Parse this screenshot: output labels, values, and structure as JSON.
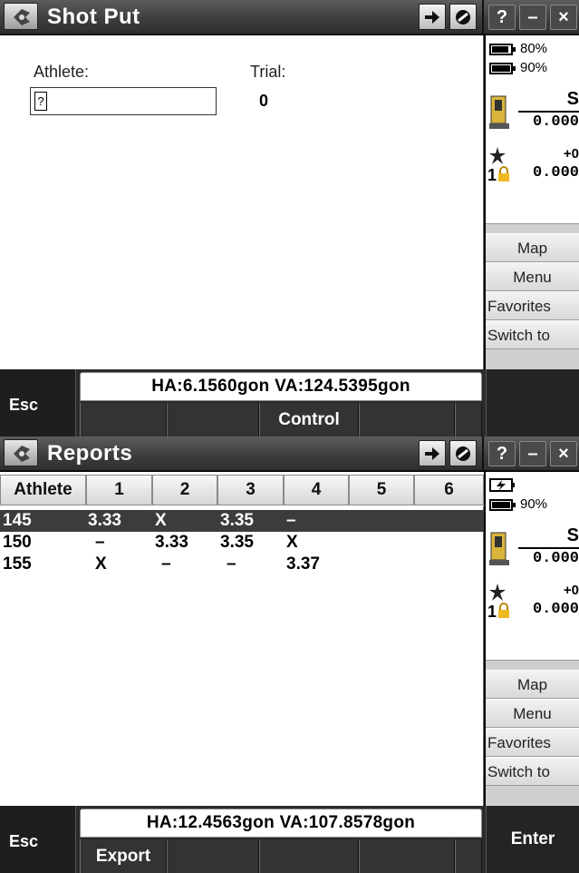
{
  "colors": {
    "titlebar": "#3e3e3e",
    "content_bg": "#ffffff",
    "selected_row": "#3c3c3c",
    "bottombar": "#2b2b2b"
  },
  "icons": {
    "app": "app-logo-icon",
    "options": "arrow-right-icon",
    "stop": "stop-icon"
  },
  "system_buttons": {
    "help": "?",
    "minimize": "–",
    "close": "×"
  },
  "shotput": {
    "title": "Shot Put",
    "athlete_label": "Athlete:",
    "athlete_value": "",
    "trial_label": "Trial:",
    "trial_value": "0",
    "status": "HA:6.1560gon  VA:124.5395gon",
    "esc": "Esc",
    "softkeys": [
      "",
      "",
      "Control",
      "",
      ""
    ],
    "right_key": ""
  },
  "reports": {
    "title": "Reports",
    "columns": [
      "Athlete",
      "1",
      "2",
      "3",
      "4",
      "5",
      "6"
    ],
    "rows": [
      {
        "athlete": "145",
        "t1": "3.33",
        "t2": "X",
        "t3": "3.35",
        "t4": "–"
      },
      {
        "athlete": "150",
        "t1": "–",
        "t2": "3.33",
        "t3": "3.35",
        "t4": "X"
      },
      {
        "athlete": "155",
        "t1": "X",
        "t2": "–",
        "t3": "–",
        "t4": "3.37"
      }
    ],
    "selected_row": 0,
    "status": "HA:12.4563gon  VA:107.8578gon",
    "esc": "Esc",
    "softkeys": [
      "Export",
      "",
      "",
      "",
      ""
    ],
    "right_key": "Enter"
  },
  "sidebar_top": {
    "battery1": {
      "text": "80%",
      "level": 0.8
    },
    "battery2": {
      "text": "90%",
      "level": 0.9
    },
    "instrument_letter": "S",
    "instrument_value": "0.000",
    "target_offset": "+0",
    "target_number": "1",
    "target_value": "0.000",
    "buttons": [
      "Map",
      "Menu",
      "Favorites",
      "Switch to"
    ]
  },
  "sidebar_bottom": {
    "battery1": {
      "text": "",
      "level": 0.0
    },
    "battery2": {
      "text": "90%",
      "level": 0.9
    },
    "instrument_letter": "S",
    "instrument_value": "0.000",
    "target_offset": "+0",
    "target_number": "1",
    "target_value": "0.000",
    "buttons": [
      "Map",
      "Menu",
      "Favorites",
      "Switch to"
    ]
  }
}
